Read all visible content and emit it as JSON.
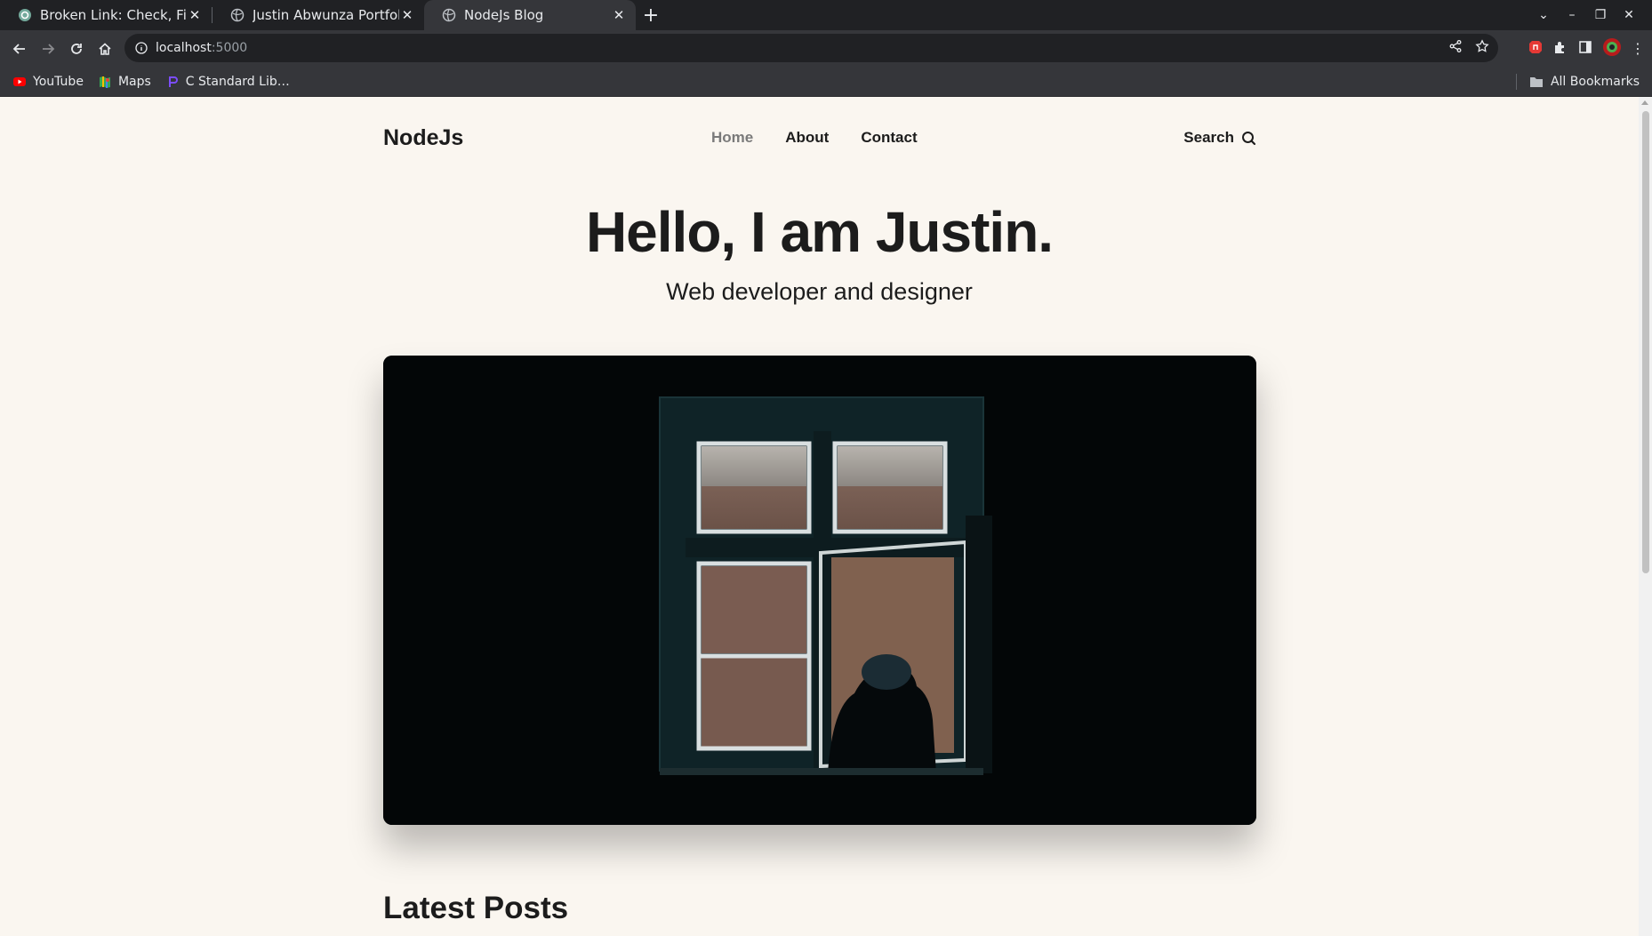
{
  "browser": {
    "tabs": [
      {
        "title": "Broken Link: Check, Fix, A",
        "favicon": "chatgpt-icon",
        "active": false
      },
      {
        "title": "Justin Abwunza Portfolio",
        "favicon": "globe-icon",
        "active": false
      },
      {
        "title": "NodeJs Blog",
        "favicon": "globe-icon",
        "active": true
      }
    ],
    "address": {
      "host": "localhost",
      "port": ":5000"
    },
    "bookmarks": [
      {
        "label": "YouTube",
        "icon": "youtube-icon"
      },
      {
        "label": "Maps",
        "icon": "maps-icon"
      },
      {
        "label": "C Standard Lib…",
        "icon": "bookmark-icon"
      }
    ],
    "all_bookmarks_label": "All Bookmarks"
  },
  "site": {
    "logo": "NodeJs",
    "nav": [
      {
        "label": "Home",
        "current": true
      },
      {
        "label": "About",
        "current": false
      },
      {
        "label": "Contact",
        "current": false
      }
    ],
    "search_label": "Search"
  },
  "hero": {
    "title": "Hello, I am Justin.",
    "subtitle": "Web developer and designer"
  },
  "latest_posts_heading": "Latest Posts"
}
